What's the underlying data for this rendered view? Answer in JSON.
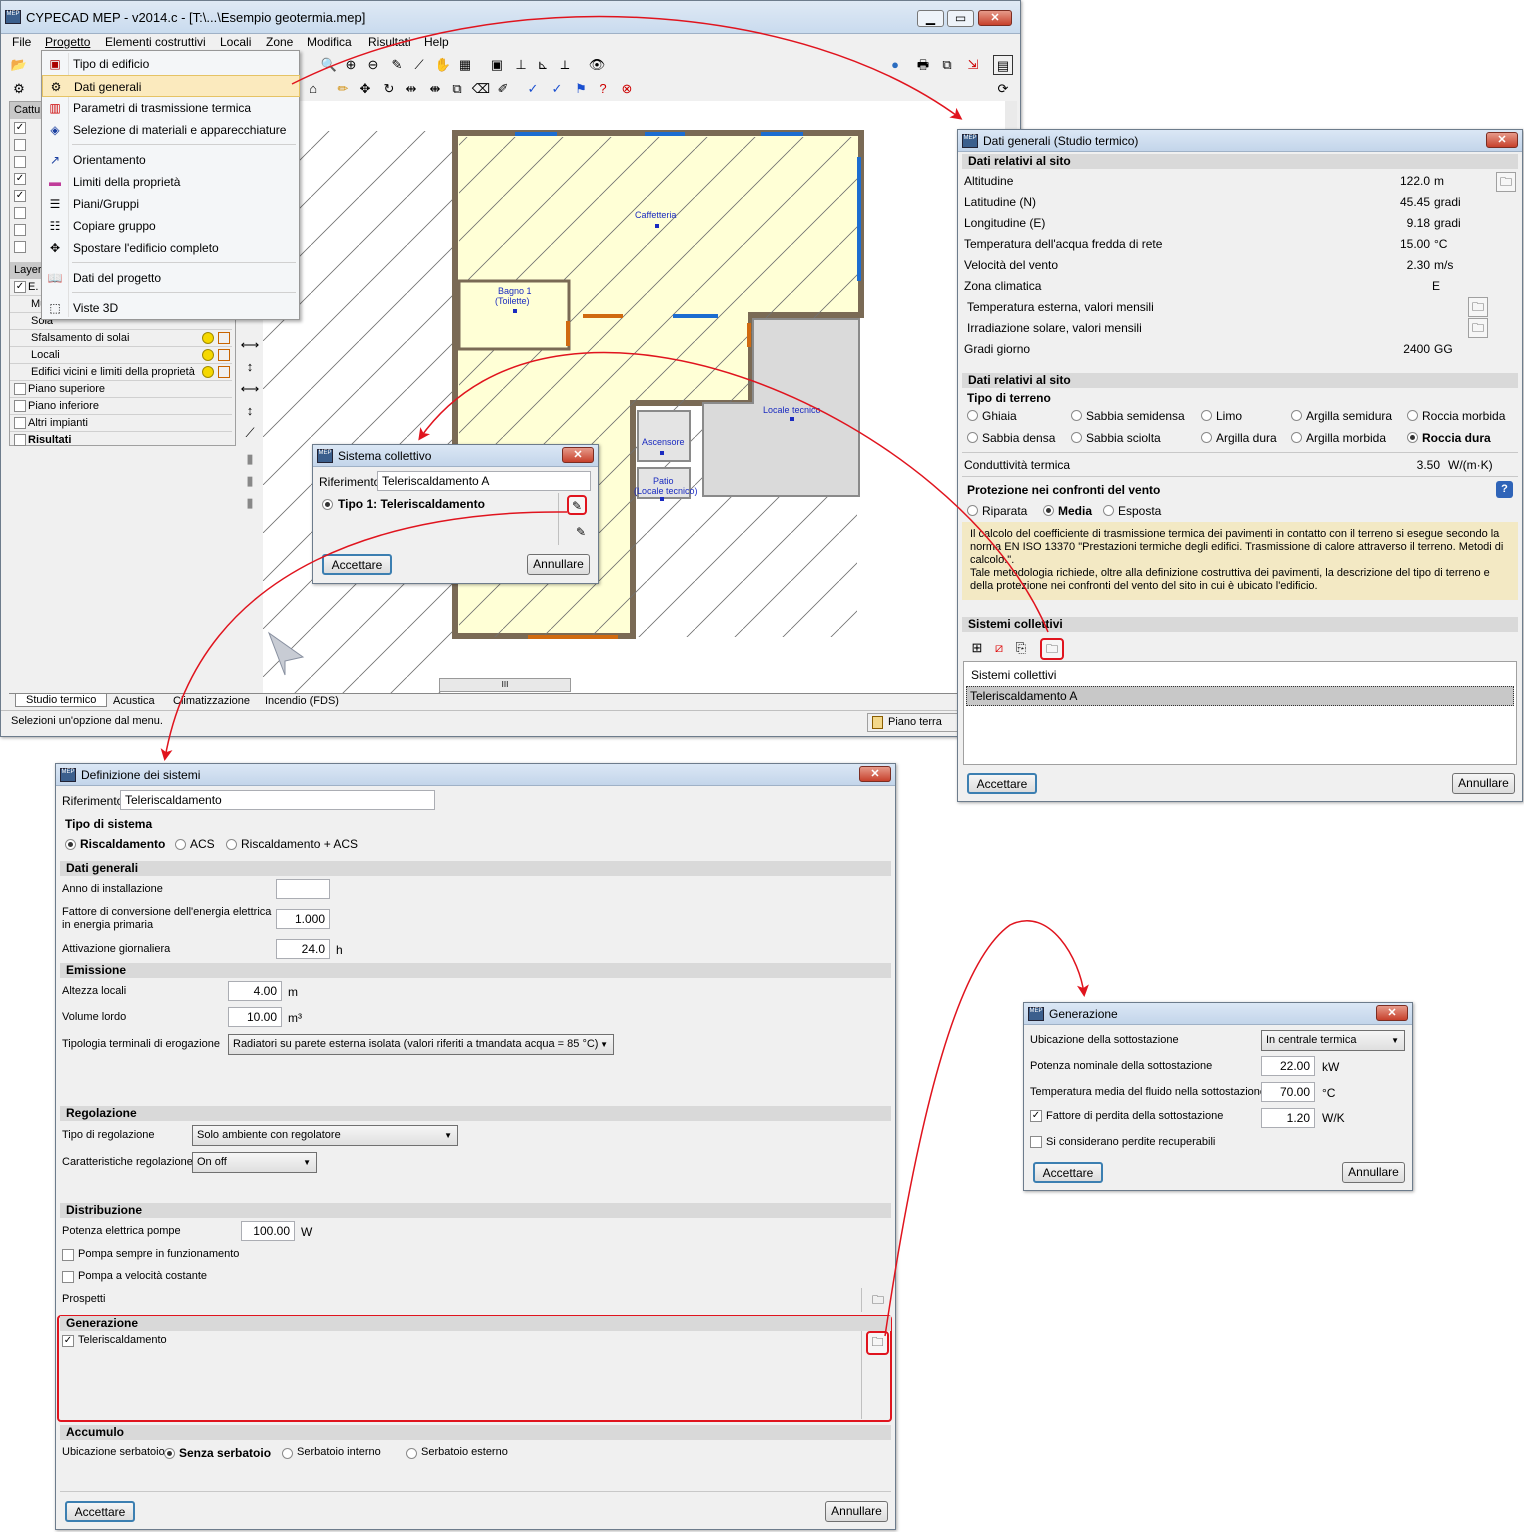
{
  "main": {
    "title": "CYPECAD MEP - v2014.c - [T:\\...\\Esempio geotermia.mep]",
    "menu": [
      "File",
      "Progetto",
      "Elementi costruttivi",
      "Locali",
      "Zone",
      "Modifica",
      "Risultati",
      "Help"
    ],
    "menu_items": [
      "Tipo di edificio",
      "Dati generali",
      "Parametri di trasmissione termica",
      "Selezione di materiali e apparecchiature",
      "Orientamento",
      "Limiti della proprietà",
      "Piani/Gruppi",
      "Copiare gruppo",
      "Spostare l'edificio completo",
      "Dati del progetto",
      "Viste 3D"
    ],
    "left_header": "Cattur",
    "layer_header": "Layer",
    "layer_first": "E.",
    "layer_rows": [
      "Mu",
      "Sola",
      "Sfalsamento di solai",
      "Locali",
      "Edifici vicini e limiti della proprietà",
      "Piano superiore",
      "Piano inferiore",
      "Altri impianti",
      "Risultati"
    ],
    "rooms": [
      "Caffetteria",
      "Bagno 1",
      "(Toilette)",
      "Locale tecnico",
      "Ascensore",
      "Patio",
      "(Locale tecnico)"
    ],
    "tabs": [
      "Studio termico",
      "Acustica",
      "Climatizzazione",
      "Incendio (FDS)"
    ],
    "status": "Selezioni un'opzione dal menu.",
    "floor": "Piano terra",
    "scroll_mark": "III"
  },
  "sistema": {
    "title": "Sistema collettivo",
    "ref_label": "Riferimento",
    "ref_value": "Teleriscaldamento A",
    "tipo": "Tipo 1: Teleriscaldamento",
    "ok": "Accettare",
    "cancel": "Annullare"
  },
  "dati": {
    "title": "Dati generali (Studio termico)",
    "s1": "Dati relativi al sito",
    "rows": [
      {
        "l": "Altitudine",
        "v": "122.0",
        "u": "m"
      },
      {
        "l": "Latitudine (N)",
        "v": "45.45",
        "u": "gradi"
      },
      {
        "l": "Longitudine (E)",
        "v": "9.18",
        "u": "gradi"
      },
      {
        "l": "Temperatura dell'acqua fredda di rete",
        "v": "15.00",
        "u": "°C"
      },
      {
        "l": "Velocità del vento",
        "v": "2.30",
        "u": "m/s"
      },
      {
        "l": "Zona climatica",
        "v": "E",
        "u": ""
      }
    ],
    "temp_est": "Temperatura esterna, valori mensili",
    "irr": "Irradiazione solare, valori mensili",
    "gg_l": "Gradi giorno",
    "gg_v": "2400",
    "gg_u": "GG",
    "s2": "Dati relativi al sito",
    "tipo_terreno": "Tipo di terreno",
    "terreni": [
      "Ghiaia",
      "Sabbia semidensa",
      "Limo",
      "Argilla semidura",
      "Roccia morbida",
      "Sabbia densa",
      "Sabbia sciolta",
      "Argilla dura",
      "Argilla morbida",
      "Roccia dura"
    ],
    "cond_l": "Conduttività termica",
    "cond_v": "3.50",
    "cond_u": "W/(m·K)",
    "prot": "Protezione nei confronti del vento",
    "prot_opts": [
      "Riparata",
      "Media",
      "Esposta"
    ],
    "note1": "Il calcolo del coefficiente di trasmissione termica dei pavimenti in contatto con il terreno si esegue secondo la norma EN ISO 13370 \"Prestazioni termiche degli edifici. Trasmissione di calore attraverso il terreno. Metodi di calcolo.\".",
    "note2": "Tale metodologia richiede, oltre alla definizione costruttiva dei pavimenti, la descrizione del tipo di terreno e della protezione nei confronti del vento del sito in cui è ubicato l'edificio.",
    "s3": "Sistemi collettivi",
    "list_header": "Sistemi collettivi",
    "list_item": "Teleriscaldamento A",
    "ok": "Accettare",
    "cancel": "Annullare"
  },
  "def": {
    "title": "Definizione dei sistemi",
    "ref_label": "Riferimento",
    "ref_value": "Teleriscaldamento",
    "tipo": "Tipo di sistema",
    "tipi": [
      "Riscaldamento",
      "ACS",
      "Riscaldamento + ACS"
    ],
    "s_dati": "Dati generali",
    "anno": "Anno di installazione",
    "fatt1": "Fattore di conversione dell'energia elettrica",
    "fatt2": "in energia primaria",
    "fatt_v": "1.000",
    "att": "Attivazione giornaliera",
    "att_v": "24.0",
    "att_u": "h",
    "s_em": "Emissione",
    "alt": "Altezza locali",
    "alt_v": "4.00",
    "alt_u": "m",
    "vol": "Volume lordo",
    "vol_v": "10.00",
    "vol_u": "m³",
    "tip": "Tipologia terminali di erogazione",
    "tip_v": "Radiatori su parete esterna isolata (valori riferiti a tmandata acqua = 85 °C)",
    "s_reg": "Regolazione",
    "treg": "Tipo di regolazione",
    "treg_v": "Solo ambiente con regolatore",
    "creg": "Caratteristiche regolazione",
    "creg_v": "On off",
    "s_dis": "Distribuzione",
    "pot": "Potenza elettrica pompe",
    "pot_v": "100.00",
    "pot_u": "W",
    "pompa1": "Pompa sempre in funzionamento",
    "pompa2": "Pompa a velocità costante",
    "prosp": "Prospetti",
    "s_gen": "Generazione",
    "gen_item": "Teleriscaldamento",
    "s_acc": "Accumulo",
    "ubi": "Ubicazione serbatoio",
    "ubis": [
      "Senza serbatoio",
      "Serbatoio interno",
      "Serbatoio esterno"
    ],
    "ok": "Accettare",
    "cancel": "Annullare"
  },
  "gen": {
    "title": "Generazione",
    "ubi": "Ubicazione della sottostazione",
    "ubi_v": "In centrale termica",
    "pot": "Potenza nominale della sottostazione",
    "pot_v": "22.00",
    "pot_u": "kW",
    "temp": "Temperatura media del fluido nella sottostazione",
    "temp_v": "70.00",
    "temp_u": "°C",
    "fatt": "Fattore di perdita della sottostazione",
    "fatt_v": "1.20",
    "fatt_u": "W/K",
    "perd": "Si considerano perdite recuperabili",
    "ok": "Accettare",
    "cancel": "Annullare"
  },
  "colors": {
    "accent": "#e0141e",
    "title_bar": "#c3d5ea",
    "plan_fill": "#ffffd6",
    "note_bg": "#f3e9c4"
  }
}
